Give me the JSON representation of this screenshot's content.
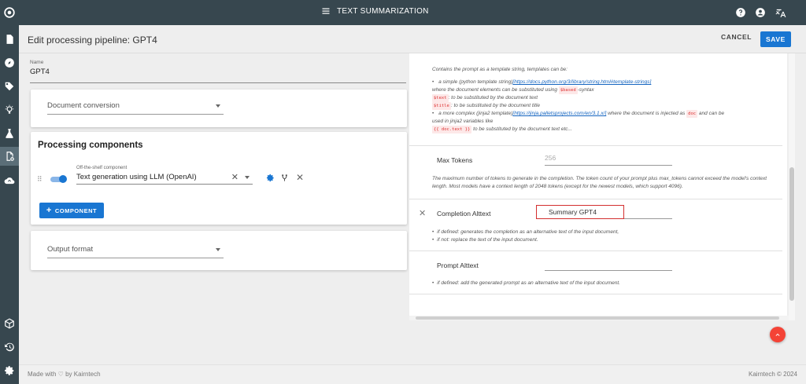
{
  "app": {
    "title": "TEXT SUMMARIZATION",
    "accent": "#1976d2",
    "rail_color": "#37474f",
    "top_right_icons": [
      "help-icon",
      "account-icon",
      "translate-icon"
    ]
  },
  "rail": {
    "top_items": [
      "document-icon",
      "compass-icon",
      "tag-icon",
      "lightbulb-icon",
      "flask-icon",
      "pipeline-doc-icon",
      "cloud-sync-icon"
    ],
    "active": "pipeline-doc-icon",
    "bottom_items": [
      "cube-icon",
      "history-icon",
      "settings-icon"
    ]
  },
  "header": {
    "title": "Edit processing pipeline: GPT4",
    "cancel_label": "CANCEL",
    "save_label": "SAVE"
  },
  "left": {
    "name_label": "Name",
    "name_value": "GPT4",
    "doc_conversion_label": "Document conversion",
    "processing_title": "Processing components",
    "component": {
      "label": "Off-the-shelf component",
      "value": "Text generation using LLM (OpenAI)",
      "enabled": true
    },
    "add_component_label": "COMPONENT",
    "output_format_label": "Output format"
  },
  "right": {
    "prompt_help": {
      "intro": "Contains the prompt as a template string, templates can be:",
      "b1_pre": "a simple (python template string)",
      "b1_link": "[https://docs.python.org/3/library/string.html#template-strings]",
      "b1_line2_pre": "where the document elements can be substituted using",
      "b1_code": "$based",
      "b1_line2_post": "-syntax",
      "code_text": "$text",
      "code_text_desc": ": to be substituted by the document text",
      "code_title": "$title",
      "code_title_desc": ": to be substituted by the document title",
      "b2_pre": "a more complex (jinja2 template)",
      "b2_link": "[https://jinja.palletsprojects.com/en/3.1.x/]",
      "b2_mid": "where the document is injected as",
      "b2_code": "doc",
      "b2_post": "and can be",
      "b2_line2": "used in jinja2 variables like",
      "code_doctext": "{{ doc.text }}",
      "code_doctext_desc": "to be substituted by the document text etc..."
    },
    "max_tokens": {
      "label": "Max Tokens",
      "value": "256",
      "help": "The maximum number of tokens to generate in the completion. The token count of your prompt plus max_tokens cannot exceed the model's context length. Most models have a context length of 2048 tokens (except for the newest models, which support 4096)."
    },
    "completion_alttext": {
      "label": "Completion Alttext",
      "value": "Summary GPT4",
      "help1": "if defined: generates the completion as an alternative text of the input document,",
      "help2": "if not: replace the text of the input document."
    },
    "prompt_alttext": {
      "label": "Prompt Alttext",
      "value": "",
      "help": "if defined: add the generated prompt as an alternative text of the input document."
    }
  },
  "footer": {
    "left": "Made with ♡ by Kairntech",
    "right": "Kairntech © 2024"
  }
}
